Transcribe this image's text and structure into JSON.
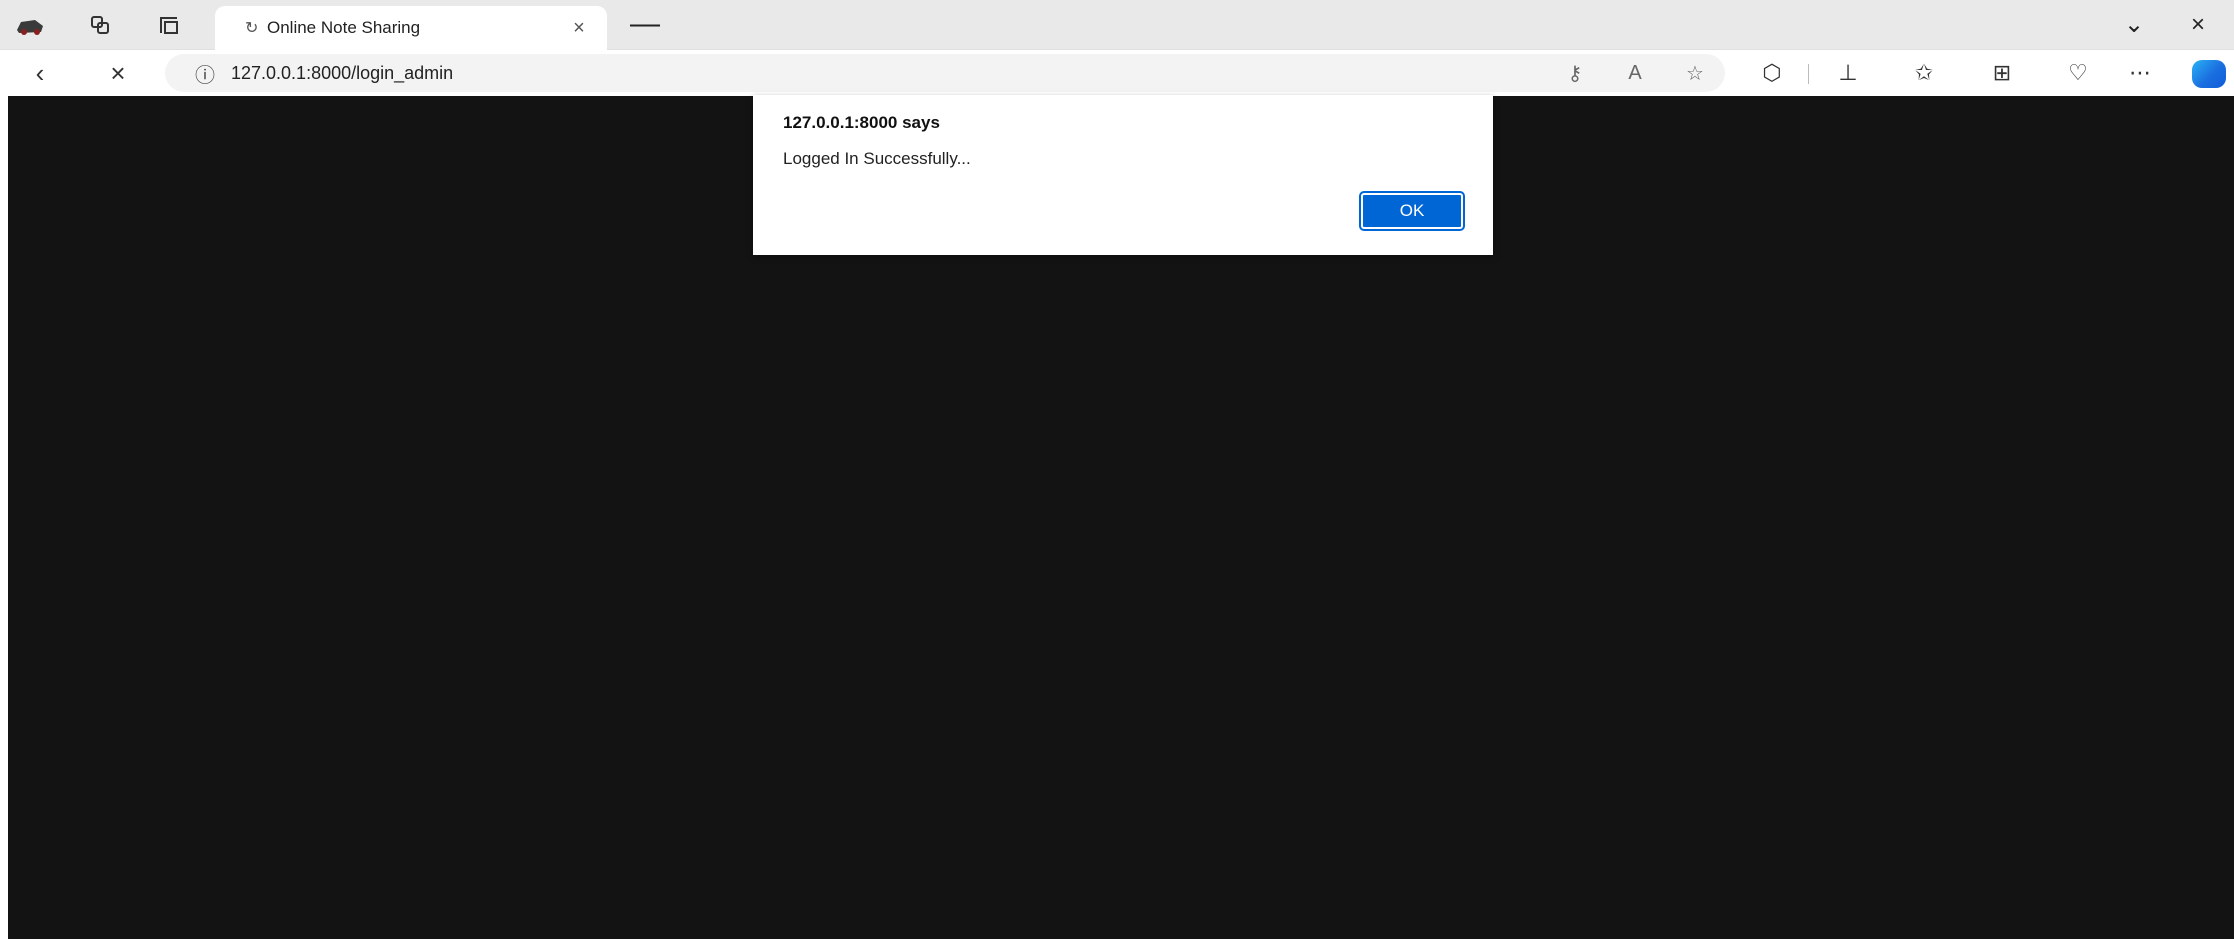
{
  "browser": {
    "tab": {
      "title": "Online Note Sharing",
      "close_glyph": "×"
    },
    "new_tab_glyph": "—",
    "window_controls": {
      "minimize": "⌄",
      "close": "×"
    },
    "address": {
      "url": "127.0.0.1:8000/login_admin"
    },
    "icons": {
      "app": "browser-app-icon",
      "workspaces": "workspaces-icon",
      "tab_actions": "tab-actions-icon",
      "back": "back-arrow-icon",
      "stop": "stop-icon",
      "site_info": "site-info-icon",
      "read_aloud": "read-aloud-icon",
      "reader": "reader-icon",
      "favorite": "favorite-star-icon",
      "extensions": "extensions-icon",
      "split": "split-screen-icon",
      "favorites": "favorites-icon",
      "collections": "collections-icon",
      "health": "browser-essentials-icon",
      "more": "more-icon",
      "copilot": "copilot-icon"
    }
  },
  "dialog": {
    "title": "127.0.0.1:8000 says",
    "message": "Logged In Successfully...",
    "ok_label": "OK"
  },
  "colors": {
    "page_background": "#131313",
    "button_accent": "#0066d6",
    "tabstrip": "#e9e9e9"
  }
}
